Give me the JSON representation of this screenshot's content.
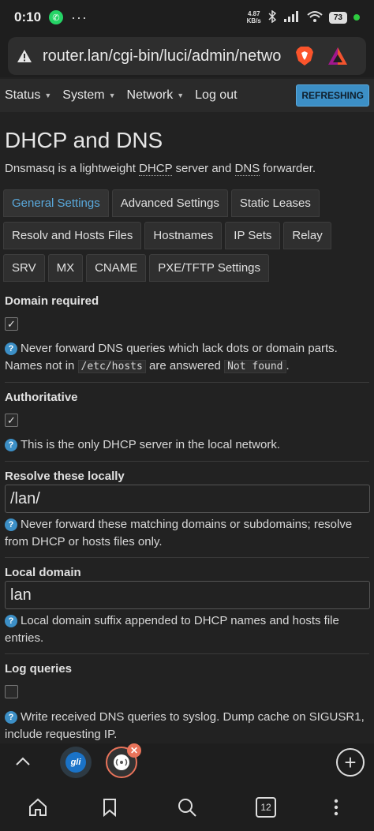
{
  "statusbar": {
    "time": "0:10",
    "dots": "···",
    "speed_value": "4.87",
    "speed_unit": "KB/s",
    "battery": "73"
  },
  "browser": {
    "url": "router.lan/cgi-bin/luci/admin/netwo"
  },
  "nav": {
    "items": [
      "Status",
      "System",
      "Network",
      "Log out"
    ],
    "refresh_label": "REFRESHING"
  },
  "page": {
    "title": "DHCP and DNS",
    "desc_prefix": "Dnsmasq is a lightweight ",
    "desc_dhcp": "DHCP",
    "desc_mid": " server and ",
    "desc_dns": "DNS",
    "desc_suffix": " forwarder."
  },
  "tabs": {
    "row1": [
      "General Settings",
      "Advanced Settings",
      "Static Leases"
    ],
    "row2": [
      "Resolv and Hosts Files",
      "Hostnames",
      "IP Sets",
      "Relay"
    ],
    "row3": [
      "SRV",
      "MX",
      "CNAME",
      "PXE/TFTP Settings"
    ]
  },
  "fields": {
    "domain_required": {
      "label": "Domain required",
      "checked": true,
      "help_a": "Never forward DNS queries which lack dots or domain parts. Names not in ",
      "help_code1": "/etc/hosts",
      "help_b": " are answered ",
      "help_code2": "Not found",
      "help_c": "."
    },
    "authoritative": {
      "label": "Authoritative",
      "checked": true,
      "help": "This is the only DHCP server in the local network."
    },
    "resolve_locally": {
      "label": "Resolve these locally",
      "value": "/lan/",
      "help": "Never forward these matching domains or subdomains; resolve from DHCP or hosts files only."
    },
    "local_domain": {
      "label": "Local domain",
      "value": "lan",
      "help": "Local domain suffix appended to DHCP names and hosts file entries."
    },
    "log_queries": {
      "label": "Log queries",
      "checked": false,
      "help": "Write received DNS queries to syslog. Dump cache on SIGUSR1, include requesting IP."
    }
  },
  "tabbar": {
    "tab1_text": "gli",
    "tab_count": "12"
  },
  "colors": {
    "accent": "#3c8fc6",
    "active_tab_text": "#5aa9dc",
    "background": "#222222"
  }
}
